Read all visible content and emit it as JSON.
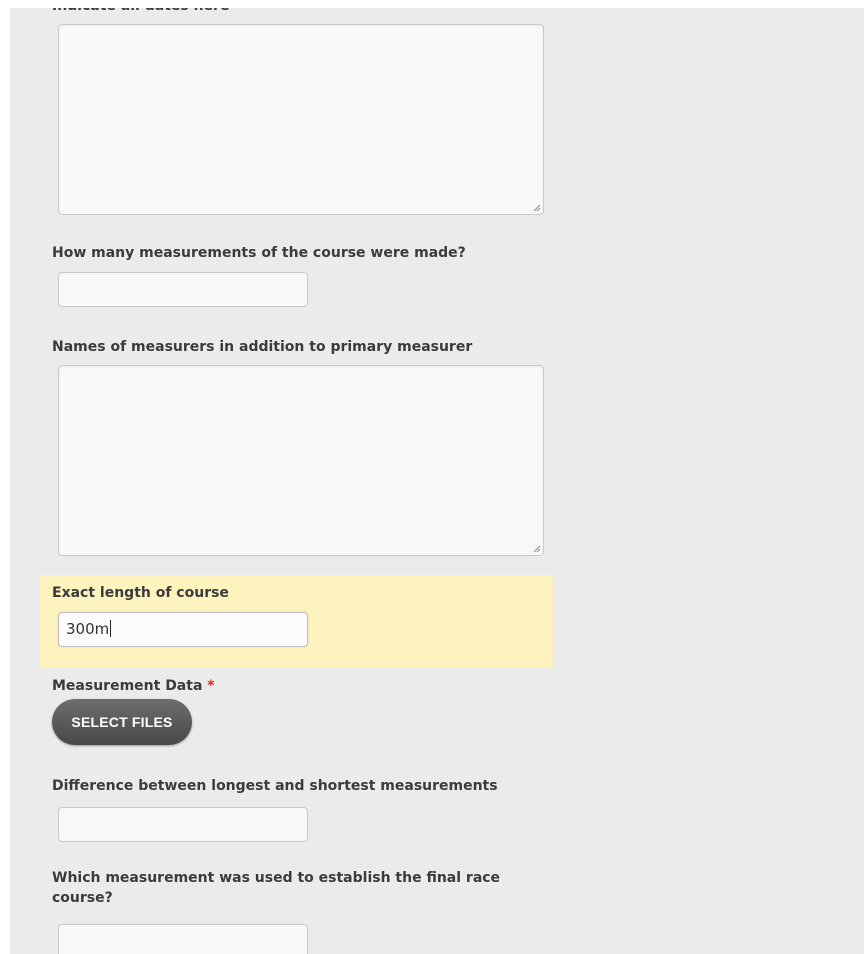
{
  "form": {
    "dates_label": "Indicate all dates here",
    "dates_value": "",
    "measurements_count_label": "How many measurements of the course were made?",
    "measurements_count_value": "",
    "other_measurers_label": "Names of measurers in addition to primary measurer",
    "other_measurers_value": "",
    "exact_length_label": "Exact length of course",
    "exact_length_value": "300m",
    "measurement_data_label": "Measurement Data",
    "measurement_data_required_marker": "*",
    "select_files_label": "SELECT FILES",
    "difference_label": "Difference between longest and shortest measurements",
    "difference_value": "",
    "final_measurement_label": "Which measurement was used to establish the final race course?",
    "final_measurement_value": ""
  },
  "colors": {
    "panel_background": "#ebebeb",
    "highlight_background": "#fdf3bf",
    "required_marker": "#d9231d",
    "button_background": "#555555"
  }
}
